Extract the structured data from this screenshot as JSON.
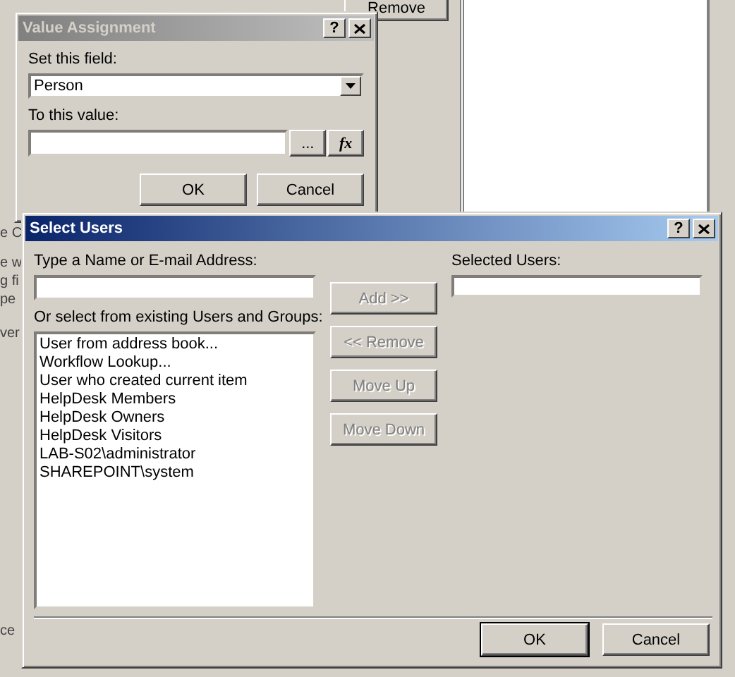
{
  "background_window": {
    "remove_button": "Remove",
    "fragments": [
      "e C",
      "e w",
      "g fi",
      "pe",
      "ver",
      "ce"
    ]
  },
  "value_assignment": {
    "title": "Value Assignment",
    "active": false,
    "title_buttons": [
      "?"
    ],
    "field_label": "Set this field:",
    "field_value": "Person",
    "value_label": "To this value:",
    "browse_button": "...",
    "formula_button": "fx",
    "buttons": [
      {
        "label": "OK",
        "default": false
      },
      {
        "label": "Cancel",
        "default": false
      }
    ]
  },
  "select_users": {
    "title": "Select Users",
    "active": true,
    "title_buttons": [
      "?"
    ],
    "name_label": "Type a Name or E-mail Address:",
    "list_label": "Or select from existing Users and Groups:",
    "users": [
      {
        "name": "User from address book...",
        "selected": false
      },
      {
        "name": "Workflow Lookup...",
        "selected": false
      },
      {
        "name": "User who created current item",
        "selected": false
      },
      {
        "name": "HelpDesk Members",
        "selected": false
      },
      {
        "name": "HelpDesk Owners",
        "selected": false
      },
      {
        "name": "HelpDesk Visitors",
        "selected": false
      },
      {
        "name": "LAB-S02\\administrator",
        "selected": false
      },
      {
        "name": "SHAREPOINT\\system",
        "selected": false
      }
    ],
    "actions": [
      {
        "label": "Add >>",
        "disabled": true
      },
      {
        "label": "<< Remove",
        "disabled": true
      },
      {
        "label": "Move Up",
        "disabled": true
      },
      {
        "label": "Move Down",
        "disabled": true
      }
    ],
    "selected_label": "Selected Users:",
    "buttons": [
      {
        "label": "OK",
        "default": true
      },
      {
        "label": "Cancel",
        "default": false
      }
    ]
  }
}
